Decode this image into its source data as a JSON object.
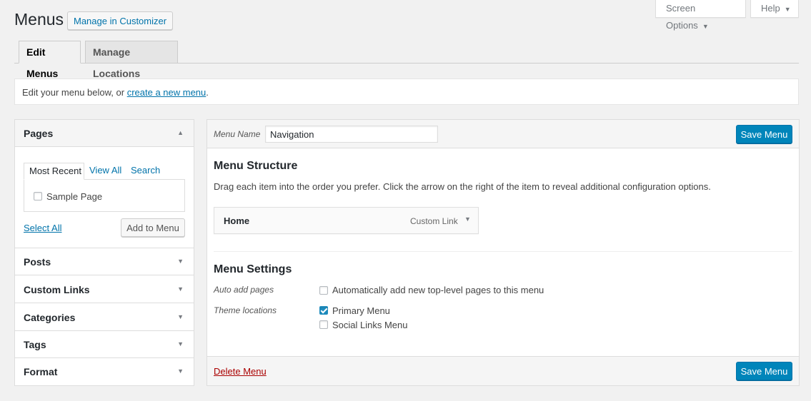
{
  "header": {
    "title": "Menus",
    "manage_customizer": "Manage in Customizer",
    "screen_options": "Screen Options",
    "help": "Help"
  },
  "tabs": [
    {
      "label": "Edit Menus",
      "active": true
    },
    {
      "label": "Manage Locations",
      "active": false
    }
  ],
  "notice": {
    "prefix": "Edit your menu below, or ",
    "link": "create a new menu",
    "suffix": "."
  },
  "sidebar": {
    "pages": {
      "title": "Pages",
      "subtabs": [
        "Most Recent",
        "View All",
        "Search"
      ],
      "items": [
        {
          "label": "Sample Page",
          "checked": false
        }
      ],
      "select_all": "Select All",
      "add_button": "Add to Menu"
    },
    "sections": [
      "Posts",
      "Custom Links",
      "Categories",
      "Tags",
      "Format"
    ]
  },
  "editor": {
    "menu_name_label": "Menu Name",
    "menu_name_value": "Navigation",
    "save_button": "Save Menu",
    "structure_title": "Menu Structure",
    "structure_desc": "Drag each item into the order you prefer. Click the arrow on the right of the item to reveal additional configuration options.",
    "menu_items": [
      {
        "title": "Home",
        "type": "Custom Link"
      }
    ],
    "settings_title": "Menu Settings",
    "auto_add_label": "Auto add pages",
    "auto_add_option": {
      "label": "Automatically add new top-level pages to this menu",
      "checked": false
    },
    "theme_locations_label": "Theme locations",
    "theme_locations": [
      {
        "label": "Primary Menu",
        "checked": true
      },
      {
        "label": "Social Links Menu",
        "checked": false
      }
    ],
    "delete_menu": "Delete Menu"
  },
  "colors": {
    "primary": "#0085ba",
    "link": "#0073aa",
    "delete": "#a00000",
    "background": "#f1f1f1"
  }
}
